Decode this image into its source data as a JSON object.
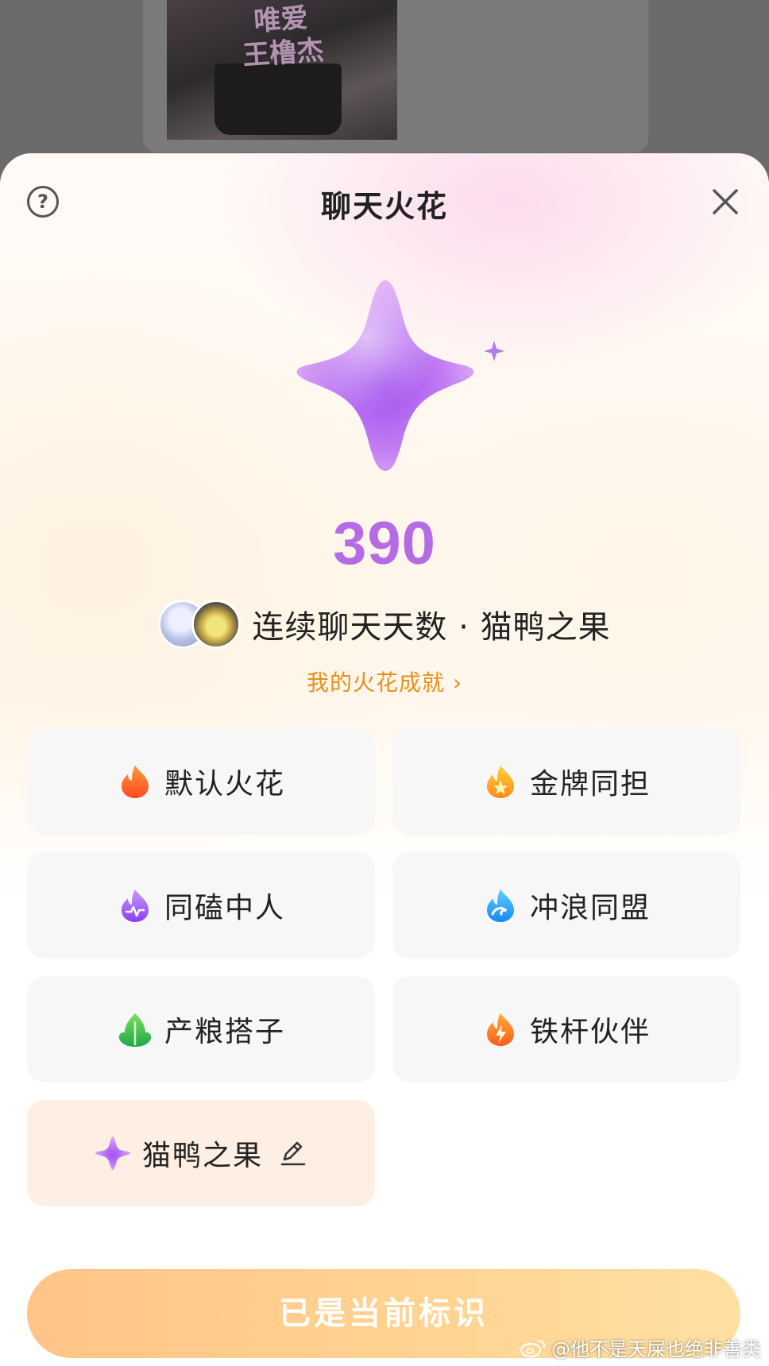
{
  "background": {
    "photo_text": "唯爱\n王橹杰"
  },
  "sheet": {
    "title": "聊天火花",
    "score": "390",
    "info_text": "连续聊天天数 · 猫鸭之果",
    "achievement_link": "我的火花成就 ›",
    "tiles": [
      {
        "label": "默认火花",
        "icon": "orange-flame-icon"
      },
      {
        "label": "金牌同担",
        "icon": "gold-star-flame-icon"
      },
      {
        "label": "同磕中人",
        "icon": "purple-flame-icon"
      },
      {
        "label": "冲浪同盟",
        "icon": "blue-wave-flame-icon"
      },
      {
        "label": "产粮搭子",
        "icon": "green-leaf-icon"
      },
      {
        "label": "铁杆伙伴",
        "icon": "lightning-flame-icon"
      },
      {
        "label": "猫鸭之果",
        "icon": "purple-sparkle-icon",
        "selected": true
      }
    ],
    "cta_label": "已是当前标识"
  },
  "watermark": "@他不是天屎也绝非善类",
  "colors": {
    "accent_purple": "#b66be6",
    "link_orange": "#e6901c",
    "selected_tile": "#fdefe3",
    "cta_gradient_start": "#ffc487",
    "cta_gradient_end": "#ffe0a3"
  }
}
